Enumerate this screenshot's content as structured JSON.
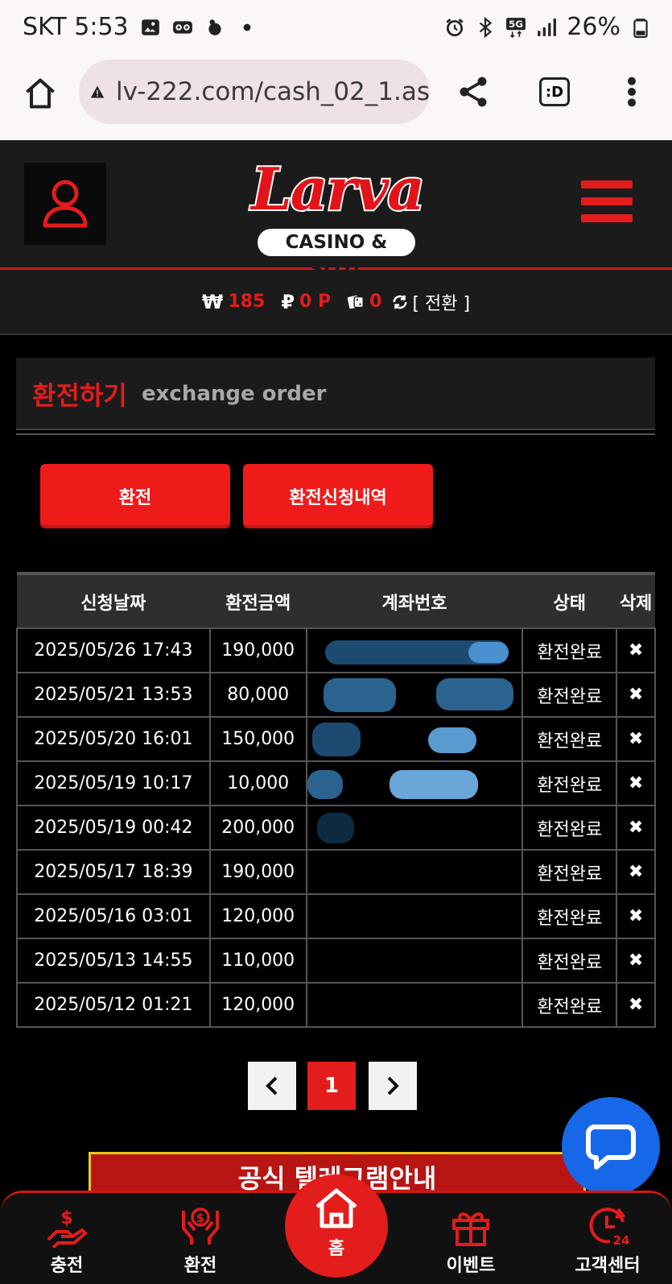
{
  "status_bar": {
    "carrier_time": "SKT 5:53",
    "battery": "26%",
    "icons": [
      "image-icon",
      "voicemail-icon",
      "bixby-icon",
      "dot-icon",
      "alarm-icon",
      "bluetooth-icon",
      "5g-icon",
      "signal-icon",
      "battery-icon"
    ]
  },
  "browser": {
    "url": "lv-222.com/cash_02_1.as",
    "tabs_label": ":D"
  },
  "header": {
    "logo_main": "Larva",
    "logo_sub": "CASINO & SLOT"
  },
  "balance": {
    "won_symbol": "₩",
    "won_value": "185",
    "point_symbol": "₽",
    "point_value": "0 P",
    "chip_value": "0",
    "convert_label": "[ 전환 ]"
  },
  "page": {
    "title_kr": "환전하기",
    "title_en": "exchange order",
    "tab_exchange": "환전",
    "tab_history": "환전신청내역"
  },
  "table": {
    "headers": [
      "신청날짜",
      "환전금액",
      "계좌번호",
      "상태",
      "삭제"
    ],
    "rows": [
      {
        "date": "2025/05/26 17:43",
        "amount": "190,000",
        "status": "환전완료",
        "delete": "✖"
      },
      {
        "date": "2025/05/21 13:53",
        "amount": "80,000",
        "status": "환전완료",
        "delete": "✖"
      },
      {
        "date": "2025/05/20 16:01",
        "amount": "150,000",
        "status": "환전완료",
        "delete": "✖"
      },
      {
        "date": "2025/05/19 10:17",
        "amount": "10,000",
        "status": "환전완료",
        "delete": "✖"
      },
      {
        "date": "2025/05/19 00:42",
        "amount": "200,000",
        "status": "환전완료",
        "delete": "✖"
      },
      {
        "date": "2025/05/17 18:39",
        "amount": "190,000",
        "status": "환전완료",
        "delete": "✖"
      },
      {
        "date": "2025/05/16 03:01",
        "amount": "120,000",
        "status": "환전완료",
        "delete": "✖"
      },
      {
        "date": "2025/05/13 14:55",
        "amount": "110,000",
        "status": "환전완료",
        "delete": "✖"
      },
      {
        "date": "2025/05/12 01:21",
        "amount": "120,000",
        "status": "환전완료",
        "delete": "✖"
      }
    ]
  },
  "pagination": {
    "prev": "‹",
    "current": "1",
    "next": "›"
  },
  "banner": {
    "text": "공식 텔레그램안내"
  },
  "bottom_nav": {
    "charge": "충전",
    "exchange": "환전",
    "home": "홈",
    "event": "이벤트",
    "support": "고객센터"
  },
  "colors": {
    "accent": "#e31c1c",
    "header_bg": "#1b1b1b",
    "chat_blue": "#1668e8"
  }
}
